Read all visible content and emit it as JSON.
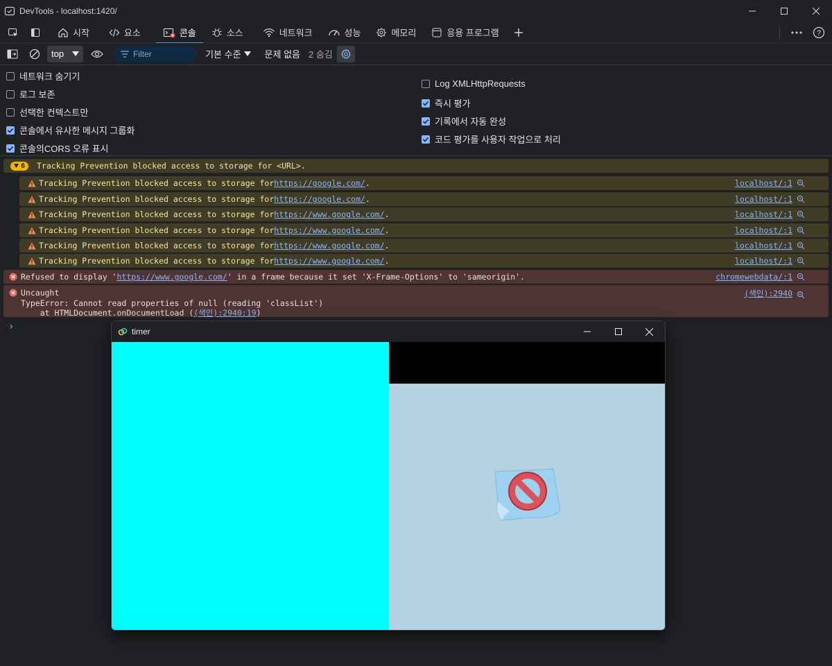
{
  "window": {
    "title": "DevTools - localhost:1420/"
  },
  "tabs": [
    {
      "label": "시작",
      "icon": "home-icon"
    },
    {
      "label": "요소",
      "icon": "code-icon"
    },
    {
      "label": "콘솔",
      "icon": "console-icon"
    },
    {
      "label": "소스",
      "icon": "bug-icon"
    },
    {
      "label": "네트워크",
      "icon": "wifi-icon"
    },
    {
      "label": "성능",
      "icon": "gauge-icon"
    },
    {
      "label": "메모리",
      "icon": "chip-icon"
    },
    {
      "label": "응용 프로그램",
      "icon": "app-window-icon"
    }
  ],
  "toolbar": {
    "context": "top",
    "filter_placeholder": "Filter",
    "level": "기본 수준",
    "issues": "문제 없음",
    "hidden": "2 숨김"
  },
  "settings": {
    "left": [
      {
        "label": "네트워크 숨기기",
        "checked": false
      },
      {
        "label": "로그 보존",
        "checked": false
      },
      {
        "label": "선택한 컨텍스트만",
        "checked": false
      },
      {
        "label": "콘솔에서 유사한 메시지 그룹화",
        "checked": true
      },
      {
        "label": "콘솔의CORS 오류 표시",
        "checked": true
      }
    ],
    "right": [
      {
        "label": "Log XMLHttpRequests",
        "checked": false
      },
      {
        "label": "즉시 평가",
        "checked": true
      },
      {
        "label": "기록에서 자동 완성",
        "checked": true
      },
      {
        "label": "코드 평가를 사용자 작업으로 처리",
        "checked": true
      }
    ]
  },
  "console": {
    "group": {
      "count": "6",
      "text": "Tracking Prevention blocked access to storage for <URL>."
    },
    "warnings": [
      {
        "prefix": "Tracking Prevention blocked access to storage for ",
        "url": "https://google.com/",
        "suffix": ".",
        "source": "localhost/:1"
      },
      {
        "prefix": "Tracking Prevention blocked access to storage for ",
        "url": "https://google.com/",
        "suffix": ".",
        "source": "localhost/:1"
      },
      {
        "prefix": "Tracking Prevention blocked access to storage for ",
        "url": "https://www.google.com/",
        "suffix": ".",
        "source": "localhost/:1"
      },
      {
        "prefix": "Tracking Prevention blocked access to storage for ",
        "url": "https://www.google.com/",
        "suffix": ".",
        "source": "localhost/:1"
      },
      {
        "prefix": "Tracking Prevention blocked access to storage for ",
        "url": "https://www.google.com/",
        "suffix": ".",
        "source": "localhost/:1"
      },
      {
        "prefix": "Tracking Prevention blocked access to storage for ",
        "url": "https://www.google.com/",
        "suffix": ".",
        "source": "localhost/:1"
      }
    ],
    "error1": {
      "prefix": "Refused to display '",
      "url": "https://www.google.com/",
      "suffix": "' in a frame because it set 'X-Frame-Options' to 'sameorigin'.",
      "source": "chromewebdata/:1"
    },
    "error2": {
      "line1": "Uncaught",
      "line2": "TypeError: Cannot read properties of null (reading 'classList')",
      "line3_prefix": "    at HTMLDocument.onDocumentLoad (",
      "line3_link": "(색인):2940:19",
      "line3_suffix": ")",
      "source": "(색인):2940"
    },
    "prompt": "›"
  },
  "timer_window": {
    "title": "timer",
    "colors": {
      "left": "#00ffff",
      "right_top": "#000000",
      "right": "#b4d2e2"
    }
  }
}
